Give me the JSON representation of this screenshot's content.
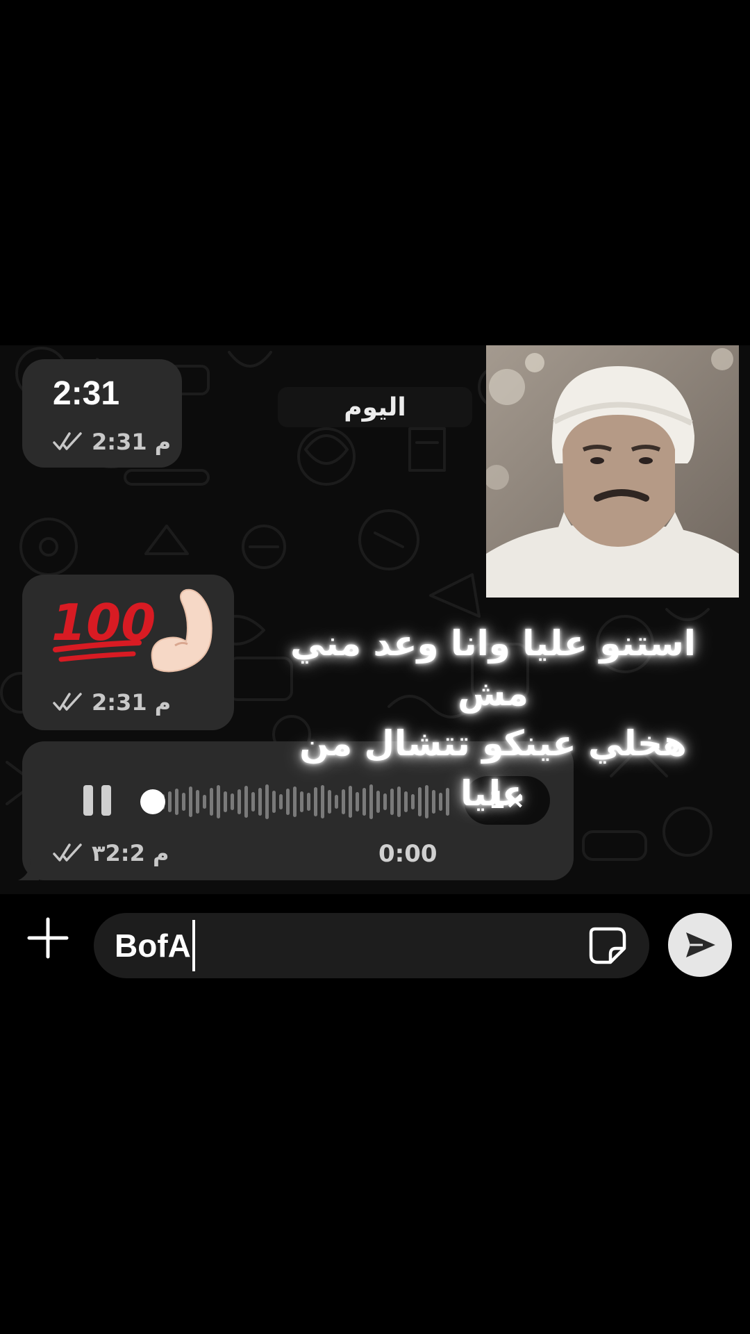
{
  "chat": {
    "date_label": "اليوم",
    "messages": [
      {
        "type": "text",
        "text": "2:31",
        "time": "2:31 م",
        "status": "read"
      },
      {
        "type": "emoji",
        "emojis": "🤌💯",
        "time": "2:31 م",
        "status": "read"
      },
      {
        "type": "voice",
        "duration": "0:00",
        "speed": "1×",
        "time": "٣2:2 م",
        "status": "read",
        "state": "playing",
        "progress": 0.0
      }
    ]
  },
  "caption": {
    "line1": "استنو عليا وانا وعد مني مش",
    "line2": "هخلي عينكو تتشال من عليا"
  },
  "composer": {
    "input_value": "BofA"
  },
  "colors": {
    "bubble": "#2b2b2b",
    "chat_background": "#0c0c0c",
    "send_button": "#e6e6e6"
  },
  "icons": {
    "add": "plus-icon",
    "sticker": "sticker-icon",
    "send": "send-icon",
    "read_receipt": "double-check-icon",
    "voice_control": "pause-icon"
  }
}
